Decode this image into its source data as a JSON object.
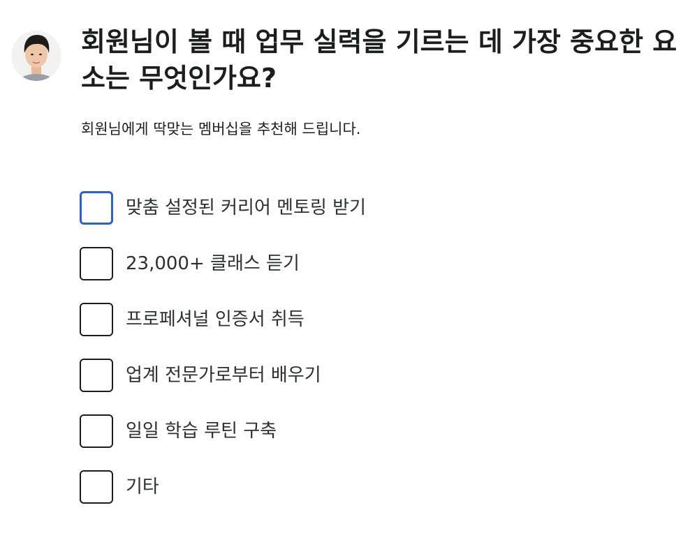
{
  "question": {
    "title": "회원님이 볼 때 업무 실력을 기르는 데 가장 중요한 요소는 무엇인가요?",
    "subtitle": "회원님에게 딱맞는 멤버십을 추천해 드립니다."
  },
  "options": [
    {
      "label": "맞춤 설정된 커리어 멘토링 받기",
      "checked": false,
      "focused": true
    },
    {
      "label": "23,000+ 클래스 듣기",
      "checked": false,
      "focused": false
    },
    {
      "label": "프로페셔널 인증서 취득",
      "checked": false,
      "focused": false
    },
    {
      "label": "업계 전문가로부터 배우기",
      "checked": false,
      "focused": false
    },
    {
      "label": "일일 학습 루틴 구축",
      "checked": false,
      "focused": false
    },
    {
      "label": "기타",
      "checked": false,
      "focused": false
    }
  ],
  "colors": {
    "text": "#1c1d1f",
    "checkbox_border": "#1c1d1f",
    "focus_border": "#2e63b5"
  },
  "icons": {
    "avatar": "person-photo"
  }
}
